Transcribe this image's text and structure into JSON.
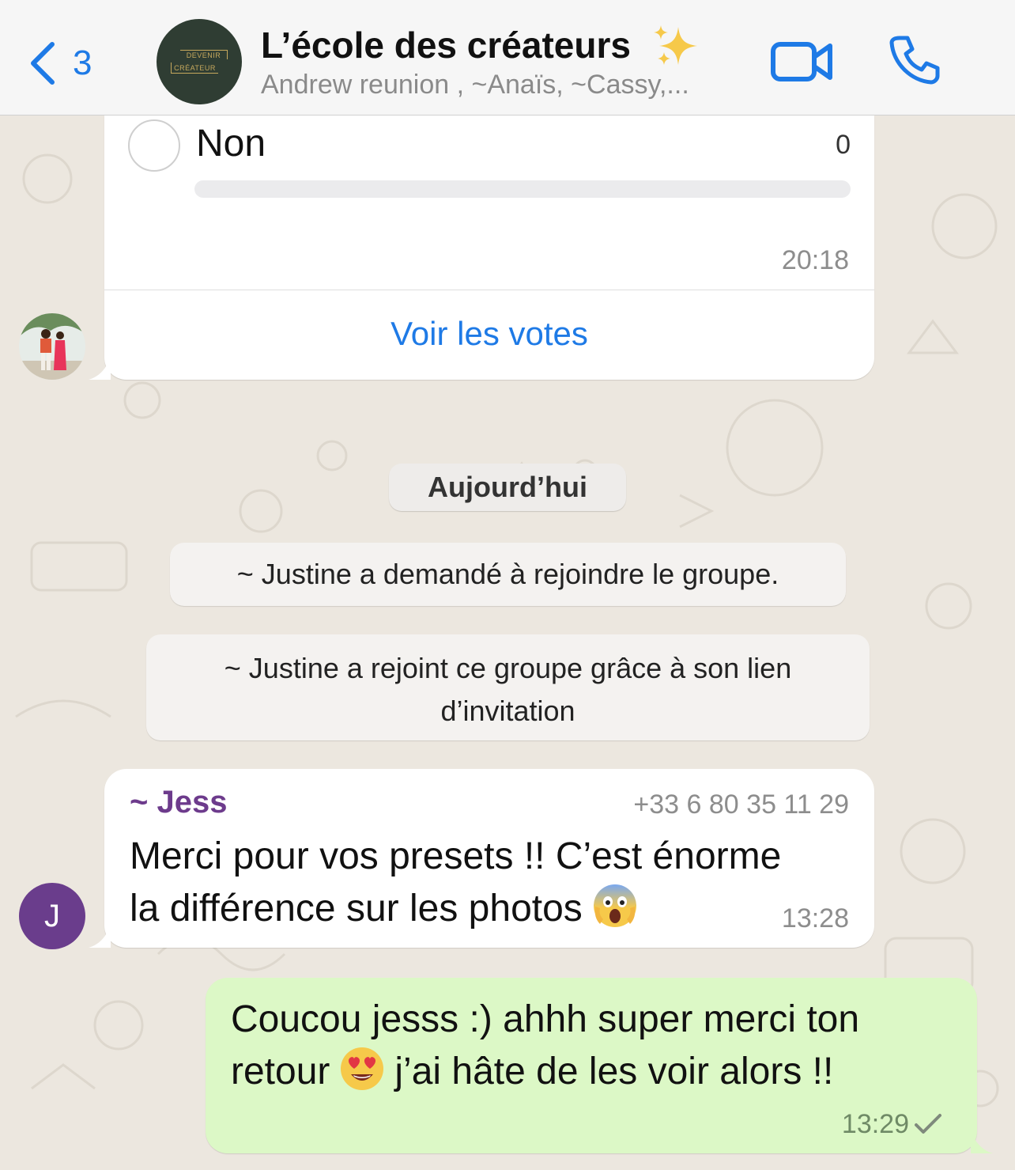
{
  "header": {
    "back_count": "3",
    "title": "L’école des créateurs",
    "subtitle": "Andrew reunion , ~Anaïs, ~Cassy,...",
    "avatar_logo": {
      "line1": "DEVENIR",
      "line2": "CRÉATEUR"
    }
  },
  "poll": {
    "option_label": "Non",
    "option_votes": "0",
    "option_fraction": 0,
    "time": "20:18",
    "view_votes_label": "Voir les votes"
  },
  "day_chip": "Aujourd’hui",
  "system_notices": [
    "~ Justine a demandé à rejoindre le groupe.",
    "~ Justine a rejoint ce groupe grâce à son lien",
    "d’invitation"
  ],
  "messages": {
    "incoming": {
      "sender": "~ Jess",
      "phone": "+33 6 80 35 11 29",
      "line1": "Merci pour vos presets !! C’est énorme",
      "line2": "la différence sur les photos",
      "emoji": "face-screaming-in-fear",
      "time": "13:28",
      "avatar_initial": "J"
    },
    "outgoing": {
      "line1": "Coucou jesss :) ahhh super merci ton",
      "line2_before": "retour",
      "emoji": "smiling-face-with-heart-eyes",
      "line2_after": "j’ai hâte de les voir alors !!",
      "time": "13:29",
      "status": "sent"
    }
  },
  "colors": {
    "accent": "#1e7ae6",
    "background": "#ece7df",
    "outgoing_bubble": "#dcf8c6",
    "sender_name": "#6d3b8c"
  }
}
